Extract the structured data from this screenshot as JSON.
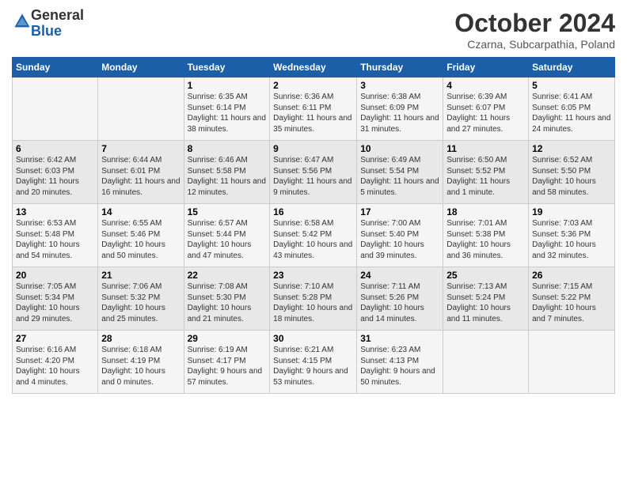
{
  "header": {
    "logo_general": "General",
    "logo_blue": "Blue",
    "month_title": "October 2024",
    "location": "Czarna, Subcarpathia, Poland"
  },
  "weekdays": [
    "Sunday",
    "Monday",
    "Tuesday",
    "Wednesday",
    "Thursday",
    "Friday",
    "Saturday"
  ],
  "weeks": [
    [
      {
        "day": "",
        "text": ""
      },
      {
        "day": "",
        "text": ""
      },
      {
        "day": "1",
        "text": "Sunrise: 6:35 AM\nSunset: 6:14 PM\nDaylight: 11 hours and 38 minutes."
      },
      {
        "day": "2",
        "text": "Sunrise: 6:36 AM\nSunset: 6:11 PM\nDaylight: 11 hours and 35 minutes."
      },
      {
        "day": "3",
        "text": "Sunrise: 6:38 AM\nSunset: 6:09 PM\nDaylight: 11 hours and 31 minutes."
      },
      {
        "day": "4",
        "text": "Sunrise: 6:39 AM\nSunset: 6:07 PM\nDaylight: 11 hours and 27 minutes."
      },
      {
        "day": "5",
        "text": "Sunrise: 6:41 AM\nSunset: 6:05 PM\nDaylight: 11 hours and 24 minutes."
      }
    ],
    [
      {
        "day": "6",
        "text": "Sunrise: 6:42 AM\nSunset: 6:03 PM\nDaylight: 11 hours and 20 minutes."
      },
      {
        "day": "7",
        "text": "Sunrise: 6:44 AM\nSunset: 6:01 PM\nDaylight: 11 hours and 16 minutes."
      },
      {
        "day": "8",
        "text": "Sunrise: 6:46 AM\nSunset: 5:58 PM\nDaylight: 11 hours and 12 minutes."
      },
      {
        "day": "9",
        "text": "Sunrise: 6:47 AM\nSunset: 5:56 PM\nDaylight: 11 hours and 9 minutes."
      },
      {
        "day": "10",
        "text": "Sunrise: 6:49 AM\nSunset: 5:54 PM\nDaylight: 11 hours and 5 minutes."
      },
      {
        "day": "11",
        "text": "Sunrise: 6:50 AM\nSunset: 5:52 PM\nDaylight: 11 hours and 1 minute."
      },
      {
        "day": "12",
        "text": "Sunrise: 6:52 AM\nSunset: 5:50 PM\nDaylight: 10 hours and 58 minutes."
      }
    ],
    [
      {
        "day": "13",
        "text": "Sunrise: 6:53 AM\nSunset: 5:48 PM\nDaylight: 10 hours and 54 minutes."
      },
      {
        "day": "14",
        "text": "Sunrise: 6:55 AM\nSunset: 5:46 PM\nDaylight: 10 hours and 50 minutes."
      },
      {
        "day": "15",
        "text": "Sunrise: 6:57 AM\nSunset: 5:44 PM\nDaylight: 10 hours and 47 minutes."
      },
      {
        "day": "16",
        "text": "Sunrise: 6:58 AM\nSunset: 5:42 PM\nDaylight: 10 hours and 43 minutes."
      },
      {
        "day": "17",
        "text": "Sunrise: 7:00 AM\nSunset: 5:40 PM\nDaylight: 10 hours and 39 minutes."
      },
      {
        "day": "18",
        "text": "Sunrise: 7:01 AM\nSunset: 5:38 PM\nDaylight: 10 hours and 36 minutes."
      },
      {
        "day": "19",
        "text": "Sunrise: 7:03 AM\nSunset: 5:36 PM\nDaylight: 10 hours and 32 minutes."
      }
    ],
    [
      {
        "day": "20",
        "text": "Sunrise: 7:05 AM\nSunset: 5:34 PM\nDaylight: 10 hours and 29 minutes."
      },
      {
        "day": "21",
        "text": "Sunrise: 7:06 AM\nSunset: 5:32 PM\nDaylight: 10 hours and 25 minutes."
      },
      {
        "day": "22",
        "text": "Sunrise: 7:08 AM\nSunset: 5:30 PM\nDaylight: 10 hours and 21 minutes."
      },
      {
        "day": "23",
        "text": "Sunrise: 7:10 AM\nSunset: 5:28 PM\nDaylight: 10 hours and 18 minutes."
      },
      {
        "day": "24",
        "text": "Sunrise: 7:11 AM\nSunset: 5:26 PM\nDaylight: 10 hours and 14 minutes."
      },
      {
        "day": "25",
        "text": "Sunrise: 7:13 AM\nSunset: 5:24 PM\nDaylight: 10 hours and 11 minutes."
      },
      {
        "day": "26",
        "text": "Sunrise: 7:15 AM\nSunset: 5:22 PM\nDaylight: 10 hours and 7 minutes."
      }
    ],
    [
      {
        "day": "27",
        "text": "Sunrise: 6:16 AM\nSunset: 4:20 PM\nDaylight: 10 hours and 4 minutes."
      },
      {
        "day": "28",
        "text": "Sunrise: 6:18 AM\nSunset: 4:19 PM\nDaylight: 10 hours and 0 minutes."
      },
      {
        "day": "29",
        "text": "Sunrise: 6:19 AM\nSunset: 4:17 PM\nDaylight: 9 hours and 57 minutes."
      },
      {
        "day": "30",
        "text": "Sunrise: 6:21 AM\nSunset: 4:15 PM\nDaylight: 9 hours and 53 minutes."
      },
      {
        "day": "31",
        "text": "Sunrise: 6:23 AM\nSunset: 4:13 PM\nDaylight: 9 hours and 50 minutes."
      },
      {
        "day": "",
        "text": ""
      },
      {
        "day": "",
        "text": ""
      }
    ]
  ]
}
